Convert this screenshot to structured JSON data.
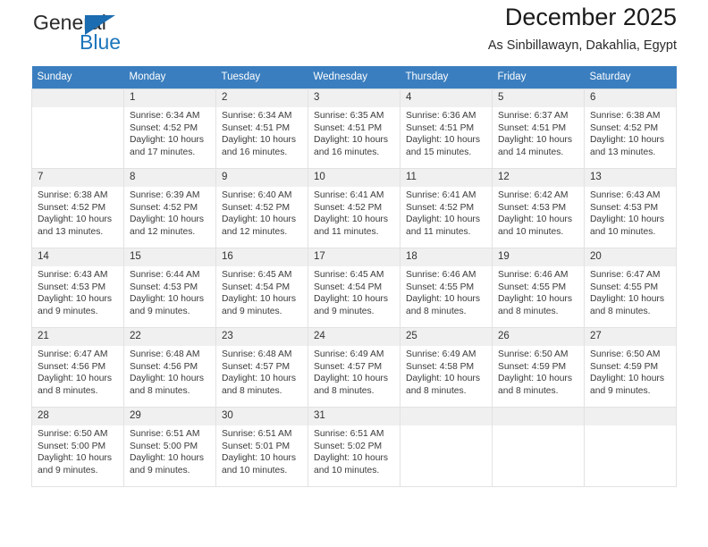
{
  "brand": {
    "name_part1": "General",
    "name_part2": "Blue",
    "logo_icon": "blue-triangle-icon"
  },
  "header": {
    "title": "December 2025",
    "subtitle": "As Sinbillawayn, Dakahlia, Egypt"
  },
  "colors": {
    "header_row_bg": "#3a7ebf",
    "brand_blue": "#1b75bb",
    "daynum_bg": "#f0f0f0",
    "cell_border": "#e2e2e2"
  },
  "weekdays": [
    "Sunday",
    "Monday",
    "Tuesday",
    "Wednesday",
    "Thursday",
    "Friday",
    "Saturday"
  ],
  "weeks": [
    [
      {
        "day": "",
        "sunrise": "",
        "sunset": "",
        "daylight_line1": "",
        "daylight_line2": ""
      },
      {
        "day": "1",
        "sunrise": "Sunrise: 6:34 AM",
        "sunset": "Sunset: 4:52 PM",
        "daylight_line1": "Daylight: 10 hours",
        "daylight_line2": "and 17 minutes."
      },
      {
        "day": "2",
        "sunrise": "Sunrise: 6:34 AM",
        "sunset": "Sunset: 4:51 PM",
        "daylight_line1": "Daylight: 10 hours",
        "daylight_line2": "and 16 minutes."
      },
      {
        "day": "3",
        "sunrise": "Sunrise: 6:35 AM",
        "sunset": "Sunset: 4:51 PM",
        "daylight_line1": "Daylight: 10 hours",
        "daylight_line2": "and 16 minutes."
      },
      {
        "day": "4",
        "sunrise": "Sunrise: 6:36 AM",
        "sunset": "Sunset: 4:51 PM",
        "daylight_line1": "Daylight: 10 hours",
        "daylight_line2": "and 15 minutes."
      },
      {
        "day": "5",
        "sunrise": "Sunrise: 6:37 AM",
        "sunset": "Sunset: 4:51 PM",
        "daylight_line1": "Daylight: 10 hours",
        "daylight_line2": "and 14 minutes."
      },
      {
        "day": "6",
        "sunrise": "Sunrise: 6:38 AM",
        "sunset": "Sunset: 4:52 PM",
        "daylight_line1": "Daylight: 10 hours",
        "daylight_line2": "and 13 minutes."
      }
    ],
    [
      {
        "day": "7",
        "sunrise": "Sunrise: 6:38 AM",
        "sunset": "Sunset: 4:52 PM",
        "daylight_line1": "Daylight: 10 hours",
        "daylight_line2": "and 13 minutes."
      },
      {
        "day": "8",
        "sunrise": "Sunrise: 6:39 AM",
        "sunset": "Sunset: 4:52 PM",
        "daylight_line1": "Daylight: 10 hours",
        "daylight_line2": "and 12 minutes."
      },
      {
        "day": "9",
        "sunrise": "Sunrise: 6:40 AM",
        "sunset": "Sunset: 4:52 PM",
        "daylight_line1": "Daylight: 10 hours",
        "daylight_line2": "and 12 minutes."
      },
      {
        "day": "10",
        "sunrise": "Sunrise: 6:41 AM",
        "sunset": "Sunset: 4:52 PM",
        "daylight_line1": "Daylight: 10 hours",
        "daylight_line2": "and 11 minutes."
      },
      {
        "day": "11",
        "sunrise": "Sunrise: 6:41 AM",
        "sunset": "Sunset: 4:52 PM",
        "daylight_line1": "Daylight: 10 hours",
        "daylight_line2": "and 11 minutes."
      },
      {
        "day": "12",
        "sunrise": "Sunrise: 6:42 AM",
        "sunset": "Sunset: 4:53 PM",
        "daylight_line1": "Daylight: 10 hours",
        "daylight_line2": "and 10 minutes."
      },
      {
        "day": "13",
        "sunrise": "Sunrise: 6:43 AM",
        "sunset": "Sunset: 4:53 PM",
        "daylight_line1": "Daylight: 10 hours",
        "daylight_line2": "and 10 minutes."
      }
    ],
    [
      {
        "day": "14",
        "sunrise": "Sunrise: 6:43 AM",
        "sunset": "Sunset: 4:53 PM",
        "daylight_line1": "Daylight: 10 hours",
        "daylight_line2": "and 9 minutes."
      },
      {
        "day": "15",
        "sunrise": "Sunrise: 6:44 AM",
        "sunset": "Sunset: 4:53 PM",
        "daylight_line1": "Daylight: 10 hours",
        "daylight_line2": "and 9 minutes."
      },
      {
        "day": "16",
        "sunrise": "Sunrise: 6:45 AM",
        "sunset": "Sunset: 4:54 PM",
        "daylight_line1": "Daylight: 10 hours",
        "daylight_line2": "and 9 minutes."
      },
      {
        "day": "17",
        "sunrise": "Sunrise: 6:45 AM",
        "sunset": "Sunset: 4:54 PM",
        "daylight_line1": "Daylight: 10 hours",
        "daylight_line2": "and 9 minutes."
      },
      {
        "day": "18",
        "sunrise": "Sunrise: 6:46 AM",
        "sunset": "Sunset: 4:55 PM",
        "daylight_line1": "Daylight: 10 hours",
        "daylight_line2": "and 8 minutes."
      },
      {
        "day": "19",
        "sunrise": "Sunrise: 6:46 AM",
        "sunset": "Sunset: 4:55 PM",
        "daylight_line1": "Daylight: 10 hours",
        "daylight_line2": "and 8 minutes."
      },
      {
        "day": "20",
        "sunrise": "Sunrise: 6:47 AM",
        "sunset": "Sunset: 4:55 PM",
        "daylight_line1": "Daylight: 10 hours",
        "daylight_line2": "and 8 minutes."
      }
    ],
    [
      {
        "day": "21",
        "sunrise": "Sunrise: 6:47 AM",
        "sunset": "Sunset: 4:56 PM",
        "daylight_line1": "Daylight: 10 hours",
        "daylight_line2": "and 8 minutes."
      },
      {
        "day": "22",
        "sunrise": "Sunrise: 6:48 AM",
        "sunset": "Sunset: 4:56 PM",
        "daylight_line1": "Daylight: 10 hours",
        "daylight_line2": "and 8 minutes."
      },
      {
        "day": "23",
        "sunrise": "Sunrise: 6:48 AM",
        "sunset": "Sunset: 4:57 PM",
        "daylight_line1": "Daylight: 10 hours",
        "daylight_line2": "and 8 minutes."
      },
      {
        "day": "24",
        "sunrise": "Sunrise: 6:49 AM",
        "sunset": "Sunset: 4:57 PM",
        "daylight_line1": "Daylight: 10 hours",
        "daylight_line2": "and 8 minutes."
      },
      {
        "day": "25",
        "sunrise": "Sunrise: 6:49 AM",
        "sunset": "Sunset: 4:58 PM",
        "daylight_line1": "Daylight: 10 hours",
        "daylight_line2": "and 8 minutes."
      },
      {
        "day": "26",
        "sunrise": "Sunrise: 6:50 AM",
        "sunset": "Sunset: 4:59 PM",
        "daylight_line1": "Daylight: 10 hours",
        "daylight_line2": "and 8 minutes."
      },
      {
        "day": "27",
        "sunrise": "Sunrise: 6:50 AM",
        "sunset": "Sunset: 4:59 PM",
        "daylight_line1": "Daylight: 10 hours",
        "daylight_line2": "and 9 minutes."
      }
    ],
    [
      {
        "day": "28",
        "sunrise": "Sunrise: 6:50 AM",
        "sunset": "Sunset: 5:00 PM",
        "daylight_line1": "Daylight: 10 hours",
        "daylight_line2": "and 9 minutes."
      },
      {
        "day": "29",
        "sunrise": "Sunrise: 6:51 AM",
        "sunset": "Sunset: 5:00 PM",
        "daylight_line1": "Daylight: 10 hours",
        "daylight_line2": "and 9 minutes."
      },
      {
        "day": "30",
        "sunrise": "Sunrise: 6:51 AM",
        "sunset": "Sunset: 5:01 PM",
        "daylight_line1": "Daylight: 10 hours",
        "daylight_line2": "and 10 minutes."
      },
      {
        "day": "31",
        "sunrise": "Sunrise: 6:51 AM",
        "sunset": "Sunset: 5:02 PM",
        "daylight_line1": "Daylight: 10 hours",
        "daylight_line2": "and 10 minutes."
      },
      {
        "day": "",
        "sunrise": "",
        "sunset": "",
        "daylight_line1": "",
        "daylight_line2": ""
      },
      {
        "day": "",
        "sunrise": "",
        "sunset": "",
        "daylight_line1": "",
        "daylight_line2": ""
      },
      {
        "day": "",
        "sunrise": "",
        "sunset": "",
        "daylight_line1": "",
        "daylight_line2": ""
      }
    ]
  ]
}
